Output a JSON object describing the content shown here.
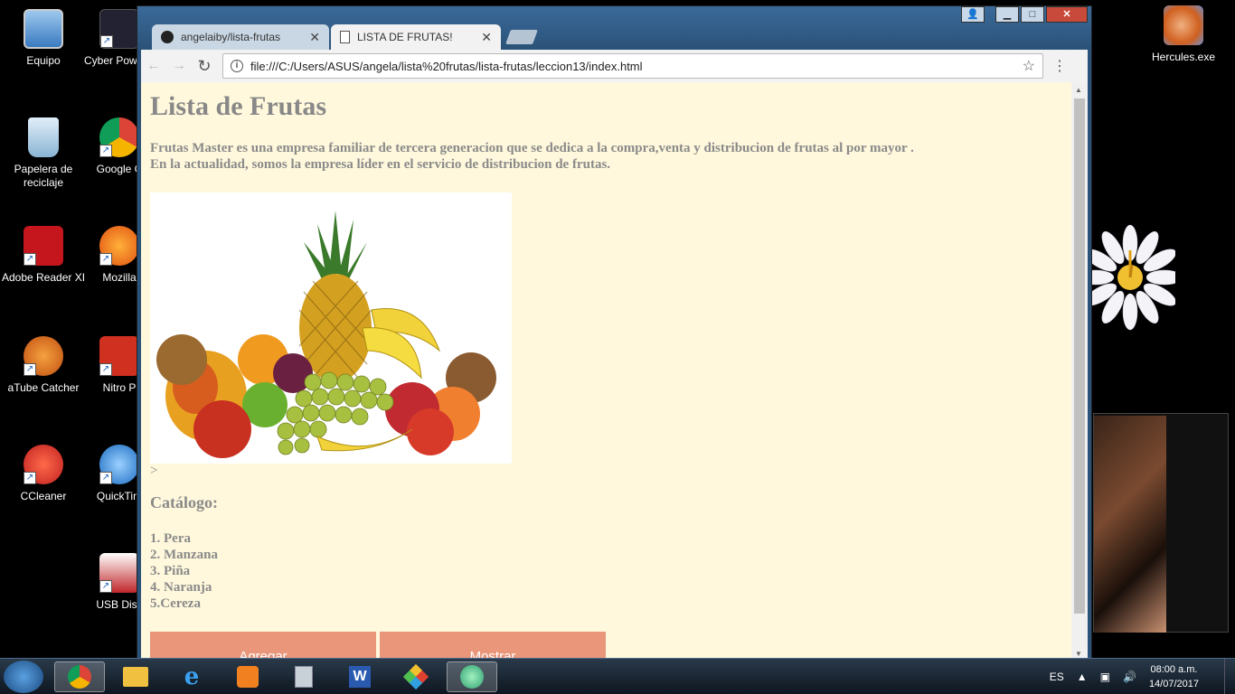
{
  "desktop": {
    "icons": [
      {
        "label": "Equipo"
      },
      {
        "label": "Cyber PowerD"
      },
      {
        "label": "Papelera de reciclaje"
      },
      {
        "label": "Google C"
      },
      {
        "label": "Adobe Reader XI"
      },
      {
        "label": "Mozilla"
      },
      {
        "label": "aTube Catcher"
      },
      {
        "label": "Nitro P"
      },
      {
        "label": "CCleaner"
      },
      {
        "label": "QuickTim"
      },
      {
        "label": "USB Disk"
      },
      {
        "label": "Hercules.exe"
      }
    ]
  },
  "browser": {
    "tabs": [
      {
        "label": "angelaiby/lista-frutas",
        "icon": "github-icon"
      },
      {
        "label": "LISTA DE FRUTAS!",
        "icon": "page-icon"
      }
    ],
    "url": "file:///C:/Users/ASUS/angela/lista%20frutas/lista-frutas/leccion13/index.html"
  },
  "page": {
    "title": "Lista de Frutas",
    "desc_line1": "Frutas Master es una empresa familiar de tercera generacion que se dedica a la compra,venta y distribucion de frutas al por mayor .",
    "desc_line2": "En la actualidad, somos la empresa líder en el servicio de distribucion de frutas.",
    "stray_text": ">",
    "catalog_heading": "Catálogo:",
    "catalog": [
      "1. Pera",
      "2. Manzana",
      "3. Piña",
      "4. Naranja",
      "5.Cereza"
    ],
    "buttons": {
      "add": "Agregar",
      "show": "Mostrar"
    },
    "bg_color": "#fff8dc",
    "button_color": "#e9967a"
  },
  "taskbar": {
    "lang": "ES",
    "time": "08:00 a.m.",
    "date": "14/07/2017"
  }
}
